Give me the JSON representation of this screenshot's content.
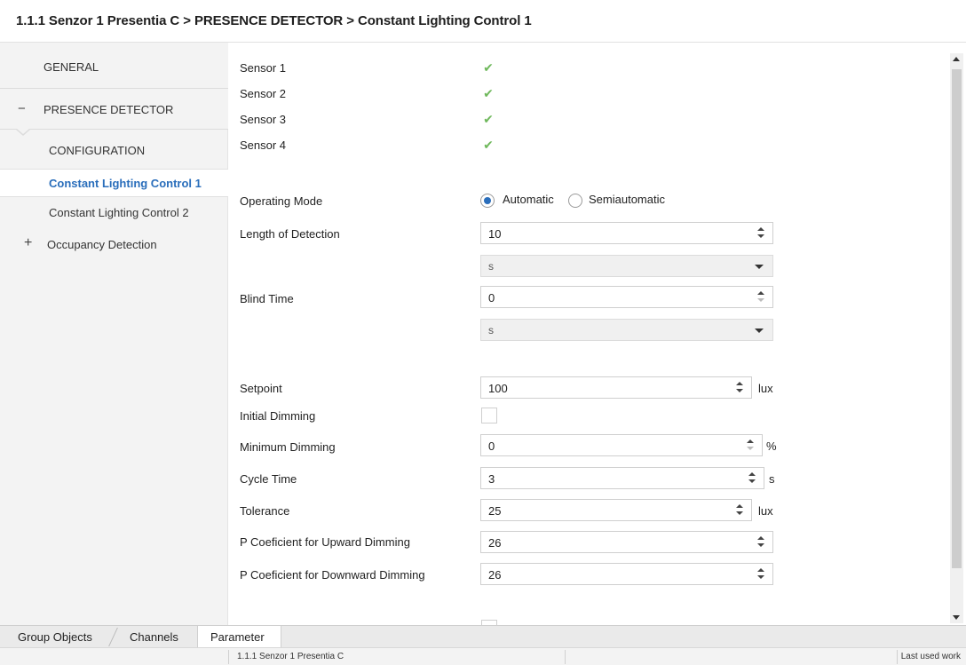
{
  "title": "1.1.1 Senzor 1 Presentia C > PRESENCE DETECTOR > Constant Lighting Control 1",
  "sidebar": {
    "general": "GENERAL",
    "presence_detector": "PRESENCE DETECTOR",
    "presence_symbol": "−",
    "configuration": "CONFIGURATION",
    "clc1": "Constant Lighting Control 1",
    "clc2": "Constant Lighting Control 2",
    "occupancy": "Occupancy Detection",
    "occupancy_symbol": "+"
  },
  "sensors": [
    {
      "label": "Sensor 1",
      "checked": true
    },
    {
      "label": "Sensor 2",
      "checked": true
    },
    {
      "label": "Sensor 3",
      "checked": true
    },
    {
      "label": "Sensor 4",
      "checked": true
    }
  ],
  "check_glyph": "✔",
  "operating_mode": {
    "label": "Operating Mode",
    "options": [
      "Automatic",
      "Semiautomatic"
    ],
    "selected": "Automatic"
  },
  "length_of_detection": {
    "label": "Length of Detection",
    "value": "10",
    "unit_option": "s"
  },
  "blind_time": {
    "label": "Blind Time",
    "value": "0",
    "unit_option": "s"
  },
  "setpoint": {
    "label": "Setpoint",
    "value": "100",
    "unit": "lux"
  },
  "initial_dimming": {
    "label": "Initial Dimming",
    "checked": false
  },
  "minimum_dimming": {
    "label": "Minimum Dimming",
    "value": "0",
    "unit": "%"
  },
  "cycle_time": {
    "label": "Cycle Time",
    "value": "3",
    "unit": "s"
  },
  "tolerance": {
    "label": "Tolerance",
    "value": "25",
    "unit": "lux"
  },
  "p_up": {
    "label": "P Coeficient for Upward Dimming",
    "value": "26"
  },
  "p_down": {
    "label": "P Coeficient for Downward Dimming",
    "value": "26"
  },
  "tabs": [
    "Group Objects",
    "Channels",
    "Parameter"
  ],
  "active_tab": "Parameter",
  "status": {
    "device": "1.1.1 Senzor 1 Presentia C",
    "right": "Last used work"
  },
  "colors": {
    "accent": "#2a6ebb",
    "check": "#6fb85c"
  }
}
